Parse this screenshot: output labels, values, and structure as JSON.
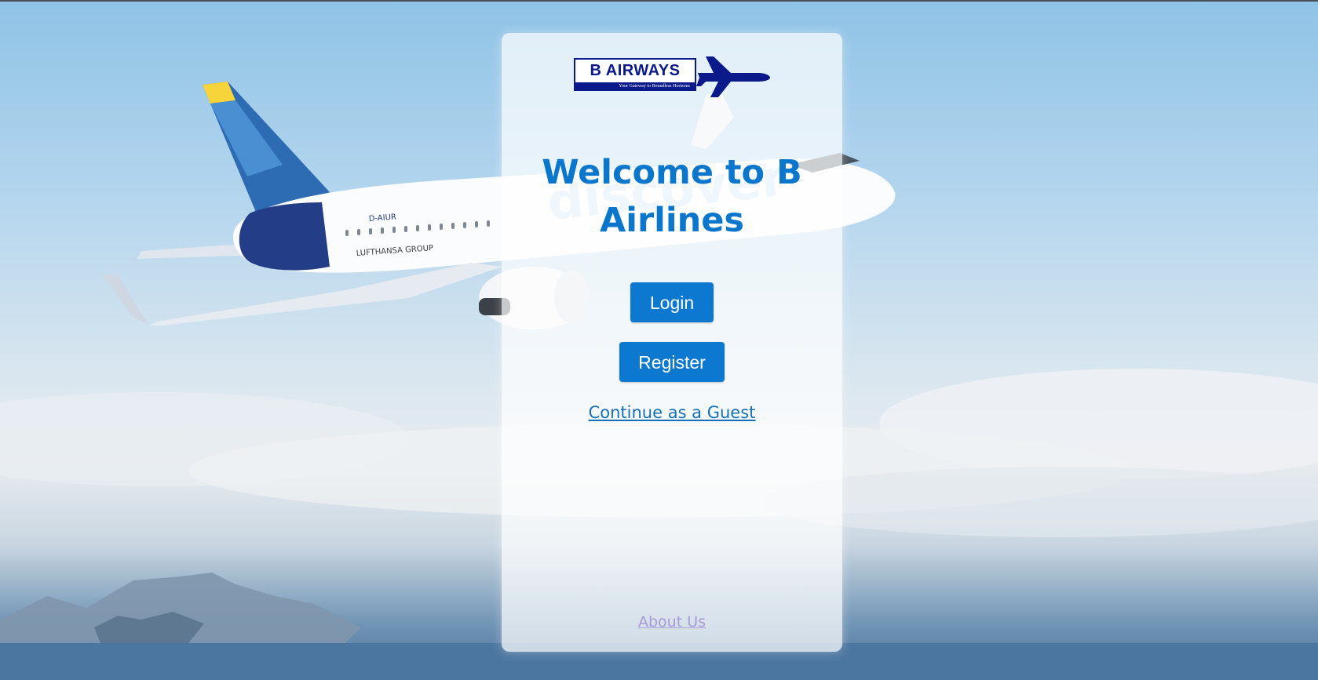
{
  "logo": {
    "brand": "B AIRWAYS",
    "tagline": "Your Gateway to Boundless Horizons",
    "colors": {
      "primary": "#0b1a8a"
    }
  },
  "welcome": {
    "title": "Welcome to B Airlines"
  },
  "actions": {
    "login_label": "Login",
    "register_label": "Register",
    "guest_label": "Continue as a Guest"
  },
  "footer": {
    "about_label": "About Us"
  },
  "theme": {
    "accent": "#0d78d0",
    "title_color": "#0b77cc",
    "link_color": "#1670b8",
    "visited_link_color": "#a79bd8"
  },
  "background": {
    "aircraft_registration": "D-AIUR",
    "aircraft_livery": "LUFTHANSA GROUP",
    "fuselage_text": "discover"
  },
  "icons": [
    "airplane-icon"
  ]
}
